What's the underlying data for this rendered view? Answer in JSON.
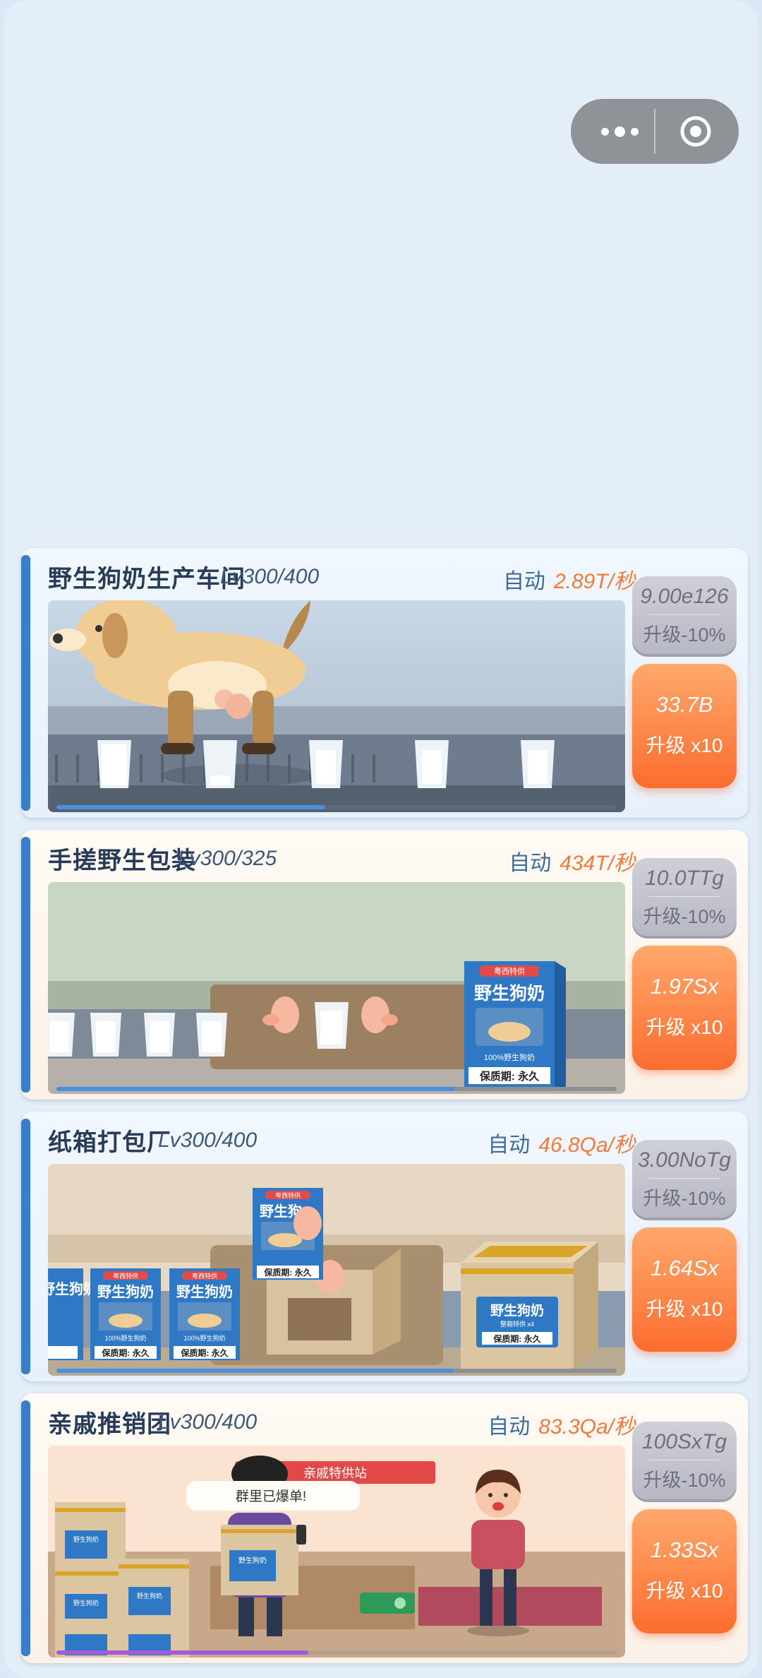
{
  "colors": {
    "accent": "#3a7ec8",
    "rate": "#ef7a3c",
    "upgrade_button": "#fb6d2f",
    "discount_button": "#b7b8c4"
  },
  "capsule": {
    "menu_icon": "more-dots-icon",
    "close_icon": "target-circle-icon"
  },
  "stations": [
    {
      "title": "野生狗奶生产车间",
      "level": "Lv300/400",
      "auto_label": "自动",
      "rate": "2.89T/秒",
      "discount_cost": "9.00e126",
      "discount_label": "升级-10%",
      "upgrade_cost": "33.7B",
      "upgrade_label": "升级 x10",
      "progress": 0.48
    },
    {
      "title": "手搓野生包装",
      "level": "Lv300/325",
      "auto_label": "自动",
      "rate": "434T/秒",
      "discount_cost": "10.0TTg",
      "discount_label": "升级-10%",
      "upgrade_cost": "1.97Sx",
      "upgrade_label": "升级 x10",
      "progress": 0.71,
      "box": {
        "top_label": "粤西特供",
        "brand": "野生狗奶",
        "sub": "100%野生狗奶",
        "shelf": "保质期: 永久"
      }
    },
    {
      "title": "纸箱打包厂",
      "level": "Lv300/400",
      "auto_label": "自动",
      "rate": "46.8Qa/秒",
      "discount_cost": "3.00NoTg",
      "discount_label": "升级-10%",
      "upgrade_cost": "1.64Sx",
      "upgrade_label": "升级 x10",
      "progress": 0.71,
      "box": {
        "top_label": "粤西特供",
        "brand": "野生狗奶",
        "brand_short": "野生狗",
        "sub": "100%野生狗奶",
        "shelf": "保质期: 永久",
        "crate_sub": "整箱特供 x4"
      }
    },
    {
      "title": "亲戚推销团",
      "level": "Lv300/400",
      "auto_label": "自动",
      "rate": "83.3Qa/秒",
      "discount_cost": "100SxTg",
      "discount_label": "升级-10%",
      "upgrade_cost": "1.33Sx",
      "upgrade_label": "升级 x10",
      "progress": 0.45,
      "banner": "亲戚特供站",
      "bubble": "群里已爆单!",
      "crate_brand": "野生狗奶"
    }
  ]
}
